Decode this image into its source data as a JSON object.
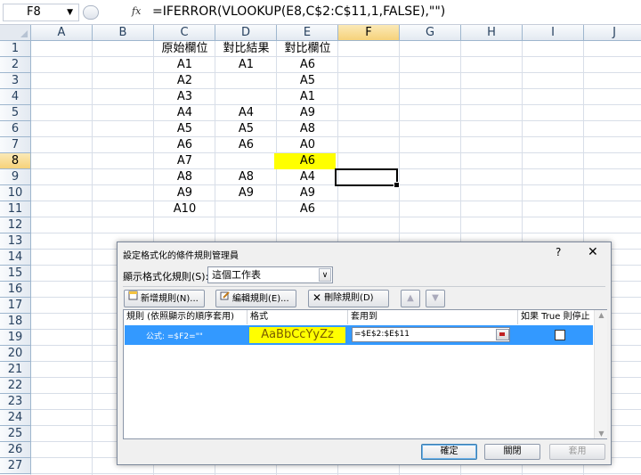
{
  "formula_bar": {
    "name_box": "F8",
    "fx": "fx",
    "formula": "=IFERROR(VLOOKUP(E8,C$2:C$11,1,FALSE),\"\")"
  },
  "columns": [
    "A",
    "B",
    "C",
    "D",
    "E",
    "F",
    "G",
    "H",
    "I",
    "J"
  ],
  "selected_column": "F",
  "rows": [
    "1",
    "2",
    "3",
    "4",
    "5",
    "6",
    "7",
    "8",
    "9",
    "10",
    "11",
    "12",
    "13",
    "14",
    "15",
    "16",
    "17",
    "18",
    "19",
    "20",
    "21",
    "22",
    "23",
    "24",
    "25",
    "26",
    "27"
  ],
  "selected_row": "8",
  "sheet": {
    "headers": {
      "c": "原始欄位",
      "d": "對比結果",
      "e": "對比欄位"
    },
    "c": [
      "A1",
      "A2",
      "A3",
      "A4",
      "A5",
      "A6",
      "A7",
      "A8",
      "A9",
      "A10"
    ],
    "d": [
      "A1",
      "",
      "",
      "A4",
      "A5",
      "A6",
      "",
      "A8",
      "A9",
      ""
    ],
    "e": [
      "A6",
      "A5",
      "A1",
      "A9",
      "A8",
      "A0",
      "A6",
      "A4",
      "A9",
      "A6"
    ],
    "highlight_color": "#ffff00"
  },
  "dialog": {
    "title": "設定格式化的條件規則管理員",
    "help": "?",
    "close": "✕",
    "show_label": "顯示格式化規則(S):",
    "scope_value": "這個工作表",
    "buttons": {
      "new": "新增規則(N)...",
      "edit": "編輯規則(E)...",
      "delete": "刪除規則(D)"
    },
    "list_headers": {
      "rule": "規則 (依照顯示的順序套用)",
      "format": "格式",
      "applies": "套用到",
      "stop": "如果 True 則停止"
    },
    "rule": {
      "text": "公式: =$F2=\"\"",
      "preview": "AaBbCcYyZz",
      "applies_to": "=$E$2:$E$11",
      "stop_if_true": false
    },
    "footer": {
      "ok": "確定",
      "close": "關閉",
      "apply": "套用"
    }
  }
}
